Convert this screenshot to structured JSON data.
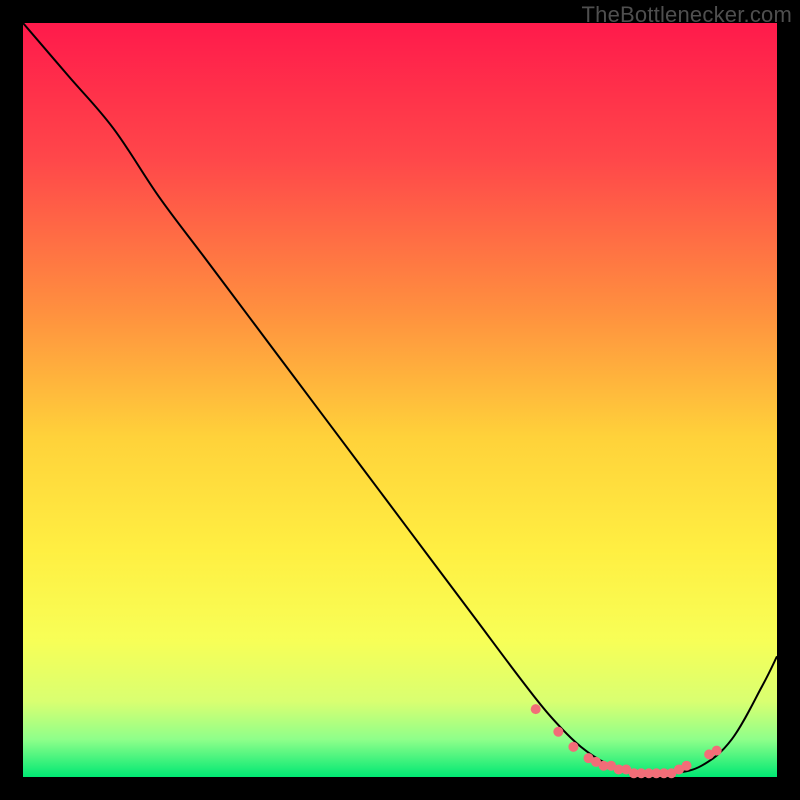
{
  "watermark": "TheBottleneсker.com",
  "gradient_stops": [
    {
      "pct": 0,
      "color": "#ff1a4b"
    },
    {
      "pct": 18,
      "color": "#ff474a"
    },
    {
      "pct": 38,
      "color": "#ff8f3f"
    },
    {
      "pct": 55,
      "color": "#ffd23a"
    },
    {
      "pct": 70,
      "color": "#ffef42"
    },
    {
      "pct": 82,
      "color": "#f7ff57"
    },
    {
      "pct": 90,
      "color": "#d9ff71"
    },
    {
      "pct": 95,
      "color": "#8fff8a"
    },
    {
      "pct": 100,
      "color": "#00e873"
    }
  ],
  "curve_color": "#000000",
  "marker_color": "#f26d78",
  "chart_data": {
    "type": "line",
    "title": "",
    "xlabel": "",
    "ylabel": "",
    "xlim": [
      0,
      100
    ],
    "ylim": [
      0,
      100
    ],
    "grid": false,
    "legend": false,
    "series": [
      {
        "name": "curve",
        "x": [
          0,
          6,
          12,
          18,
          24,
          30,
          36,
          42,
          48,
          54,
          60,
          66,
          70,
          74,
          78,
          82,
          86,
          90,
          94,
          98,
          100
        ],
        "y": [
          100,
          93,
          86,
          77,
          69,
          61,
          53,
          45,
          37,
          29,
          21,
          13,
          8,
          4,
          1.5,
          0.5,
          0.5,
          1.5,
          5,
          12,
          16
        ]
      }
    ],
    "markers": {
      "name": "highlighted-points",
      "x": [
        68,
        71,
        73,
        75,
        76,
        77,
        78,
        79,
        80,
        81,
        82,
        83,
        84,
        85,
        86,
        87,
        88,
        91,
        92
      ],
      "y": [
        9.0,
        6.0,
        4.0,
        2.5,
        2.0,
        1.5,
        1.5,
        1.0,
        1.0,
        0.5,
        0.5,
        0.5,
        0.5,
        0.5,
        0.5,
        1.0,
        1.5,
        3.0,
        3.5
      ]
    }
  }
}
